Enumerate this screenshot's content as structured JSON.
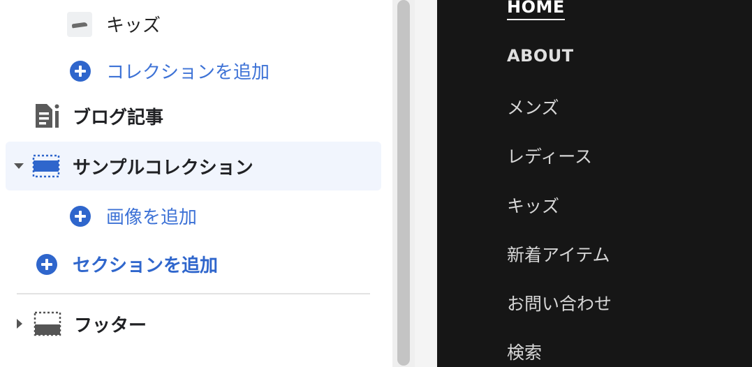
{
  "sidebar": {
    "collection_item": {
      "label": "キッズ",
      "icon": "product-thumbnail-icon"
    },
    "add_collection": {
      "label": "コレクションを追加",
      "icon": "plus-circle-icon"
    },
    "blog": {
      "label": "ブログ記事",
      "icon": "blog-post-icon"
    },
    "sample_collection": {
      "label": "サンプルコレクション",
      "icon": "section-layout-icon",
      "expanded": true,
      "selected": true
    },
    "add_image": {
      "label": "画像を追加",
      "icon": "plus-circle-icon"
    },
    "add_section": {
      "label": "セクションを追加",
      "icon": "plus-circle-icon"
    },
    "footer": {
      "label": "フッター",
      "icon": "footer-layout-icon",
      "expanded": false
    }
  },
  "preview": {
    "menu": [
      {
        "label": "HOME",
        "active": true
      },
      {
        "label": "ABOUT",
        "active": false
      },
      {
        "label": "メンズ",
        "active": false
      },
      {
        "label": "レディース",
        "active": false
      },
      {
        "label": "キッズ",
        "active": false
      },
      {
        "label": "新着アイテム",
        "active": false
      },
      {
        "label": "お問い合わせ",
        "active": false
      },
      {
        "label": "検索",
        "active": false
      }
    ]
  },
  "colors": {
    "accent": "#2f66cc",
    "selected_bg": "#f1f5fd",
    "preview_bg": "#161616"
  }
}
